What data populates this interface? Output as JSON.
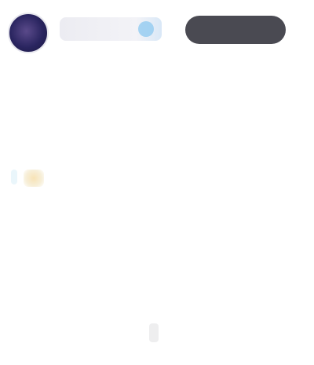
{
  "header": {
    "author_name": "",
    "follow_label": ""
  },
  "post": {
    "para1": "",
    "para2": "",
    "link_text": "",
    "para4": "",
    "para5": ""
  },
  "footer": {
    "timestamp": "",
    "source": "",
    "views": ""
  },
  "colors": {
    "button_bg": "#4a4a52",
    "link": "#4fa7d8"
  }
}
